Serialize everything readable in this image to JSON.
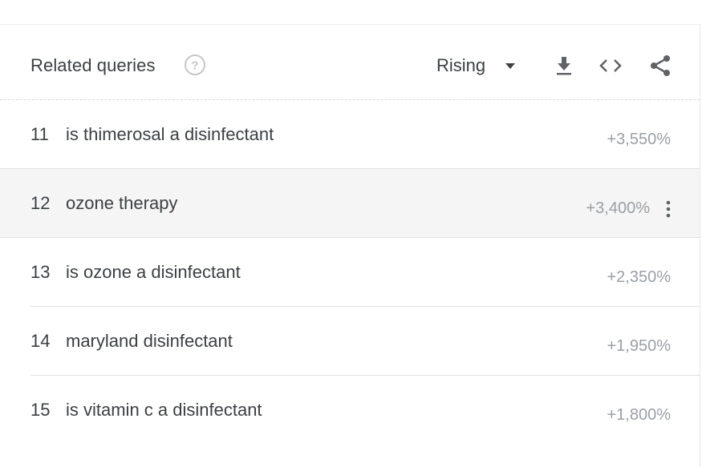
{
  "header": {
    "title": "Related queries",
    "help_icon": "help-circle-icon",
    "filter": {
      "selected": "Rising"
    },
    "tools": [
      "download-icon",
      "embed-code-icon",
      "share-icon"
    ]
  },
  "rows": [
    {
      "rank": "11",
      "query": "is thimerosal a disinfectant",
      "value": "+3,550%"
    },
    {
      "rank": "12",
      "query": "ozone therapy",
      "value": "+3,400%"
    },
    {
      "rank": "13",
      "query": "is ozone a disinfectant",
      "value": "+2,350%"
    },
    {
      "rank": "14",
      "query": "maryland disinfectant",
      "value": "+1,950%"
    },
    {
      "rank": "15",
      "query": "is vitamin c a disinfectant",
      "value": "+1,800%"
    }
  ],
  "colors": {
    "text": "#3c4043",
    "muted": "#9aa0a6",
    "highlight_bg": "#f5f5f5",
    "divider": "#e0e0e0"
  }
}
